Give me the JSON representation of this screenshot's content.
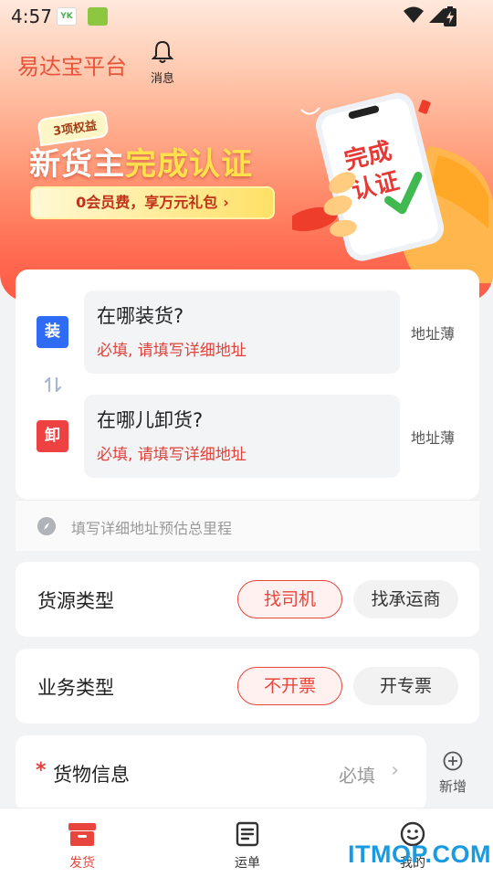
{
  "status_bar": {
    "time": "4:57",
    "app_icon_1_text": "YK",
    "wifi_icon": "wifi-icon",
    "signal_icon": "signal-icon",
    "battery_icon": "battery-charging-icon"
  },
  "header": {
    "title": "易达宝平台",
    "message_label": "消息",
    "message_icon": "bell-icon"
  },
  "banner": {
    "tag": "3项权益",
    "headline_white": "新货主",
    "headline_yellow": "完成认证",
    "cta": "0会员费，享万元礼包",
    "cta_arrow": "›",
    "phone_text_line1": "完成",
    "phone_text_line2": "认证"
  },
  "address": {
    "load": {
      "badge": "装",
      "question": "在哪装货?",
      "hint": "必填, 请填写详细地址",
      "book": "地址薄"
    },
    "unload": {
      "badge": "卸",
      "question": "在哪儿卸货?",
      "hint": "必填, 请填写详细地址",
      "book": "地址薄"
    },
    "swap_icon": "swap-vertical-icon"
  },
  "estimate": {
    "text": "填写详细地址预估总里程",
    "icon": "compass-icon"
  },
  "source_type": {
    "label": "货源类型",
    "options": [
      "找司机",
      "找承运商"
    ],
    "selected": "找司机"
  },
  "business_type": {
    "label": "业务类型",
    "options": [
      "不开票",
      "开专票"
    ],
    "selected": "不开票"
  },
  "goods": {
    "required_mark": "*",
    "label": "货物信息",
    "required_text": "必填",
    "chevron": "›",
    "add_label": "新增",
    "add_icon": "plus-circle-icon"
  },
  "tabbar": [
    {
      "label": "发货",
      "icon": "box-icon",
      "active": true
    },
    {
      "label": "运单",
      "icon": "document-list-icon",
      "active": false
    },
    {
      "label": "我的",
      "icon": "smiley-face-icon",
      "active": false
    }
  ],
  "watermark": "ITMOP.COM",
  "colors": {
    "accent": "#e8453c",
    "load_blue": "#2f6cf5",
    "unload_red": "#ee4141",
    "headline_yellow": "#ffe14d"
  }
}
